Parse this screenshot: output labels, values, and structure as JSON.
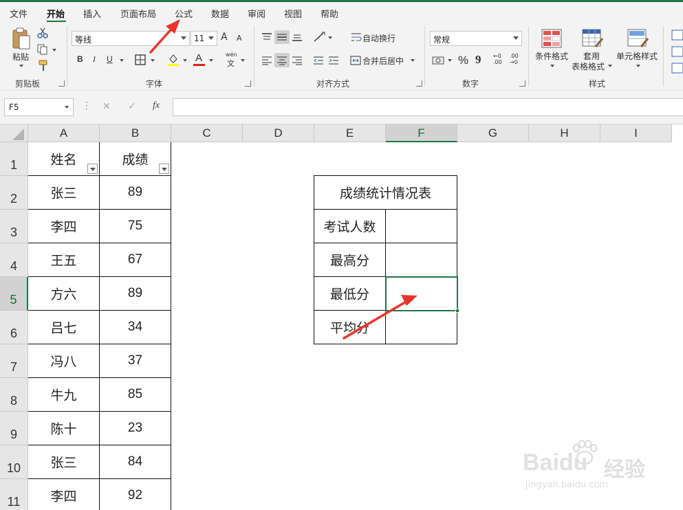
{
  "menu": {
    "items": [
      "文件",
      "开始",
      "插入",
      "页面布局",
      "公式",
      "数据",
      "审阅",
      "视图",
      "帮助"
    ],
    "active_index": 1
  },
  "ribbon": {
    "clipboard": {
      "paste_label": "粘贴",
      "group_label": "剪贴板"
    },
    "font": {
      "name": "等线",
      "size": "11",
      "group_label": "字体",
      "bold": "B",
      "italic": "I",
      "underline": "U",
      "grow": "A",
      "shrink": "A",
      "font_color_glyph": "A",
      "wen": "wén",
      "wen_char": "文"
    },
    "alignment": {
      "wrap_label": "自动换行",
      "merge_label": "合并后居中",
      "group_label": "对齐方式"
    },
    "number": {
      "format": "常规",
      "percent": "%",
      "comma": "9",
      "inc": "←0 .00",
      "dec": ".00 →0",
      "group_label": "数字"
    },
    "styles": {
      "conditional": "条件格式",
      "table_line1": "套用",
      "table_line2": "表格格式",
      "cell_styles": "单元格样式",
      "group_label": "样式"
    }
  },
  "formula_bar": {
    "name_box": "F5",
    "fx": "fx",
    "cancel": "✕",
    "enter": "✓",
    "formula": ""
  },
  "grid": {
    "columns": [
      "A",
      "B",
      "C",
      "D",
      "E",
      "F",
      "G",
      "H",
      "I"
    ],
    "selected_column": "F",
    "rows": [
      "1",
      "2",
      "3",
      "4",
      "5",
      "6",
      "7",
      "8",
      "9",
      "10",
      "11"
    ],
    "selected_row": "5",
    "headers": {
      "name": "姓名",
      "score": "成绩"
    },
    "records": [
      {
        "name": "张三",
        "score": "89"
      },
      {
        "name": "李四",
        "score": "75"
      },
      {
        "name": "王五",
        "score": "67"
      },
      {
        "name": "方六",
        "score": "89"
      },
      {
        "name": "吕七",
        "score": "34"
      },
      {
        "name": "冯八",
        "score": "37"
      },
      {
        "name": "牛九",
        "score": "85"
      },
      {
        "name": "陈十",
        "score": "23"
      },
      {
        "name": "张三",
        "score": "84"
      },
      {
        "name": "李四",
        "score": "92"
      }
    ]
  },
  "stats_table": {
    "title": "成绩统计情况表",
    "rows": [
      {
        "label": "考试人数",
        "value": ""
      },
      {
        "label": "最高分",
        "value": ""
      },
      {
        "label": "最低分",
        "value": ""
      },
      {
        "label": "平均分",
        "value": ""
      }
    ]
  },
  "watermark": {
    "brand": "Baidu",
    "brand_cn": "经验",
    "url": "jingyan.baidu.com"
  },
  "colors": {
    "accent_green": "#217346",
    "arrow_red": "#e8352c",
    "grid_line": "#111111",
    "header_bg": "#e6e6e6"
  }
}
